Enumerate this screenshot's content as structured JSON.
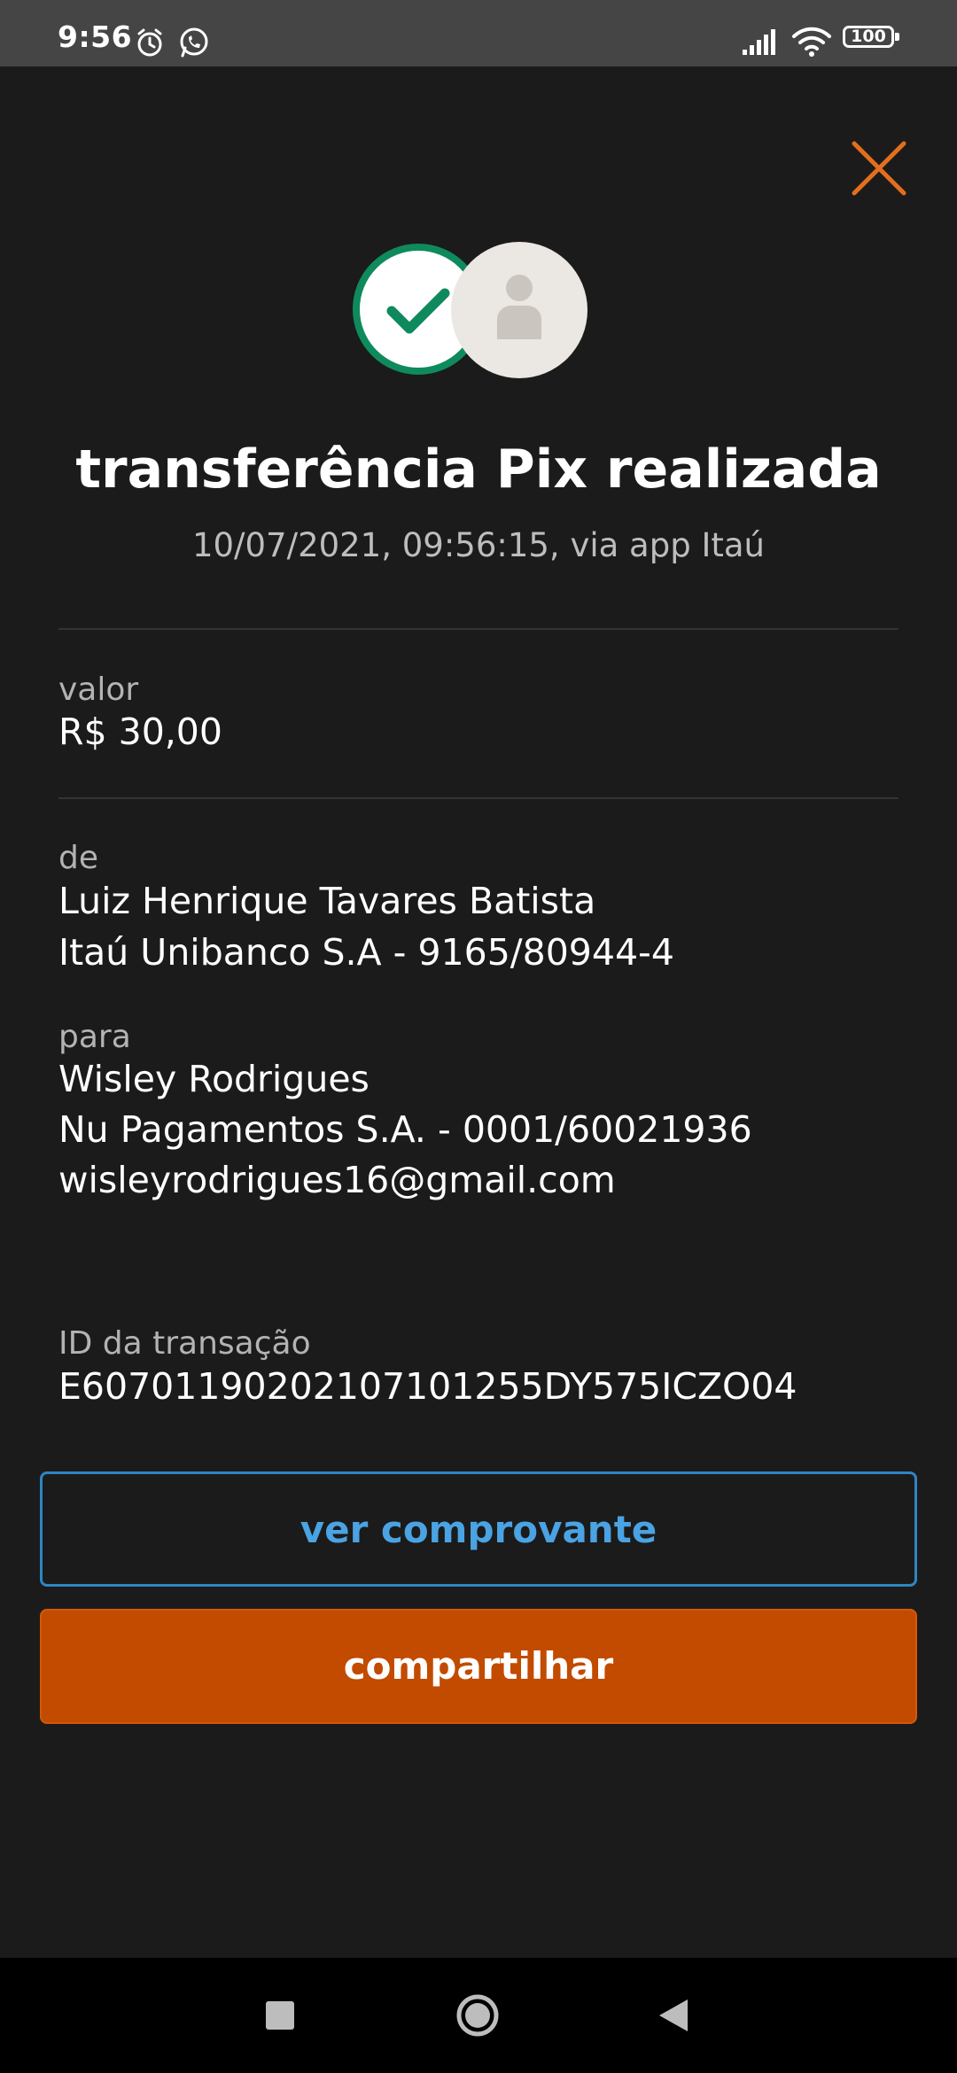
{
  "status_bar": {
    "time": "9:56",
    "icons": [
      "alarm-icon",
      "whatsapp-icon",
      "signal-icon",
      "wifi-icon"
    ],
    "battery": "100"
  },
  "header": {
    "close_icon": "close-icon",
    "accent_color": "#e36f1e"
  },
  "hero": {
    "success_icon": "check-icon",
    "recipient_avatar_icon": "person-icon",
    "title": "transferência Pix realizada",
    "subtitle": "10/07/2021,  09:56:15, via app Itaú"
  },
  "valor": {
    "label": "valor",
    "amount": "R$ 30,00"
  },
  "de": {
    "label": "de",
    "name": "Luiz Henrique Tavares Batista",
    "bank": "Itaú Unibanco S.A - 9165/80944-4"
  },
  "para": {
    "label": "para",
    "name": "Wisley Rodrigues",
    "bank": "Nu Pagamentos S.A. - 0001/60021936",
    "email": "wisleyrodrigues16@gmail.com"
  },
  "transaction": {
    "label": "ID da transação",
    "id": "E60701190202107101255DY575ICZO04"
  },
  "actions": {
    "receipt_label": "ver comprovante",
    "share_label": "compartilhar"
  },
  "nav": {
    "icons": [
      "recents-icon",
      "home-icon",
      "back-icon"
    ]
  }
}
